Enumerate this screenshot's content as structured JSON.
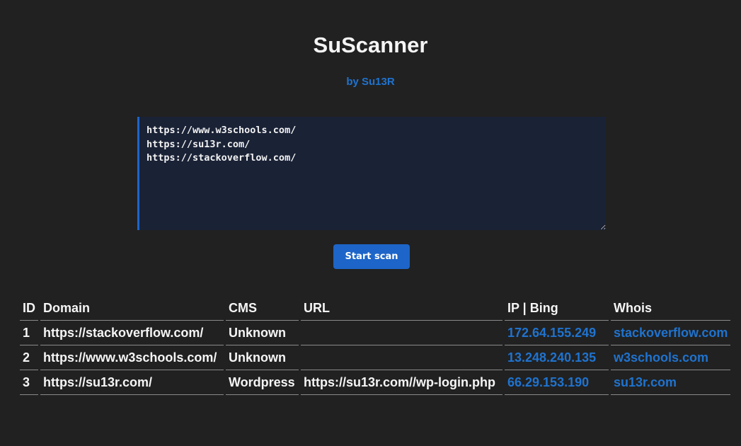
{
  "header": {
    "title": "SuScanner",
    "author": "by Su13R"
  },
  "scanner": {
    "urls_value": "https://www.w3schools.com/\nhttps://su13r.com/\nhttps://stackoverflow.com/",
    "button_label": "Start scan"
  },
  "table": {
    "columns": [
      "ID",
      "Domain",
      "CMS",
      "URL",
      "IP | Bing",
      "Whois"
    ],
    "rows": [
      {
        "id": "1",
        "domain": "https://stackoverflow.com/",
        "cms": "Unknown",
        "url": "",
        "ip": "172.64.155.249",
        "whois": "stackoverflow.com"
      },
      {
        "id": "2",
        "domain": "https://www.w3schools.com/",
        "cms": "Unknown",
        "url": "",
        "ip": "13.248.240.135",
        "whois": "w3schools.com"
      },
      {
        "id": "3",
        "domain": "https://su13r.com/",
        "cms": "Wordpress",
        "url": "https://su13r.com//wp-login.php",
        "ip": "66.29.153.190",
        "whois": "su13r.com"
      }
    ]
  },
  "colors": {
    "background": "#212121",
    "accent": "#1d65c8",
    "link": "#1f73cf",
    "textarea_background": "#1a2236"
  }
}
